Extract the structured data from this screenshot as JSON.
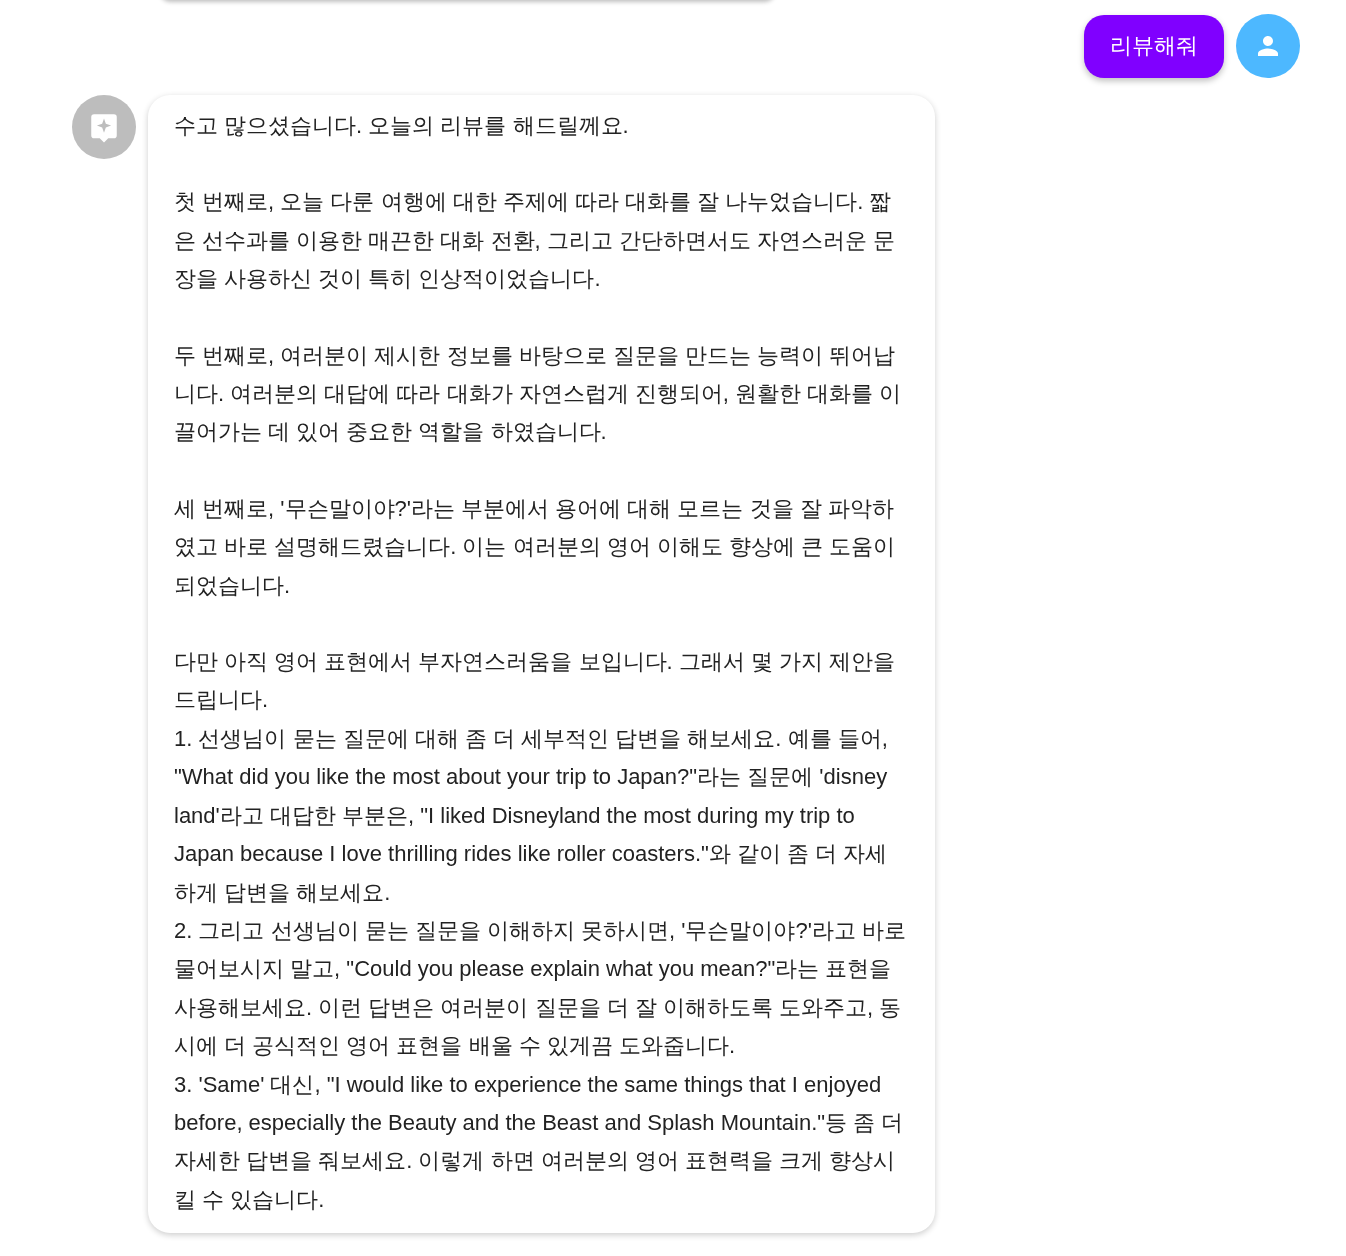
{
  "user_message": {
    "text": "리뷰해줘"
  },
  "bot_message": {
    "paragraphs": [
      {
        "lines": [
          "수고 많으셨습니다. 오늘의 리뷰를 해드릴께요."
        ]
      },
      {
        "lines": [
          "첫 번째로, 오늘 다룬 여행에 대한 주제에 따라 대화를 잘 나누었습니다. 짧은 선수과를 이용한 매끈한 대화 전환, 그리고 간단하면서도 자연스러운 문장을 사용하신 것이 특히 인상적이었습니다."
        ]
      },
      {
        "lines": [
          "두 번째로, 여러분이 제시한 정보를 바탕으로 질문을 만드는 능력이 뛰어납니다. 여러분의 대답에 따라 대화가 자연스럽게 진행되어, 원활한 대화를 이끌어가는 데 있어 중요한 역할을 하였습니다."
        ]
      },
      {
        "lines": [
          "세 번째로, '무슨말이야?'라는 부분에서 용어에 대해 모르는 것을 잘 파악하였고 바로 설명해드렸습니다. 이는 여러분의 영어 이해도 향상에 큰 도움이 되었습니다."
        ]
      },
      {
        "lines": [
          "다만 아직 영어 표현에서 부자연스러움을 보입니다. 그래서 몇 가지 제안을 드립니다.",
          "1. 선생님이 묻는 질문에 대해 좀 더 세부적인 답변을 해보세요. 예를 들어, \"What did you like the most about your trip to Japan?\"라는 질문에 'disney land'라고 대답한 부분은, \"I liked Disneyland the most during my trip to Japan because I love thrilling rides like roller coasters.\"와 같이 좀 더 자세하게 답변을 해보세요.",
          "2. 그리고 선생님이 묻는 질문을 이해하지 못하시면, '무슨말이야?'라고 바로 물어보시지 말고, \"Could you please explain what you mean?\"라는 표현을 사용해보세요. 이런 답변은 여러분이 질문을 더 잘 이해하도록 도와주고, 동시에 더 공식적인 영어 표현을 배울 수 있게끔 도와줍니다.",
          "3. 'Same' 대신, \"I would like to experience the same things that I enjoyed before, especially the Beauty and the Beast and Splash Mountain.\"등 좀 더 자세한 답변을 줘보세요. 이렇게 하면 여러분의 영어 표현력을 크게 향상시킬 수 있습니다."
        ]
      }
    ]
  }
}
